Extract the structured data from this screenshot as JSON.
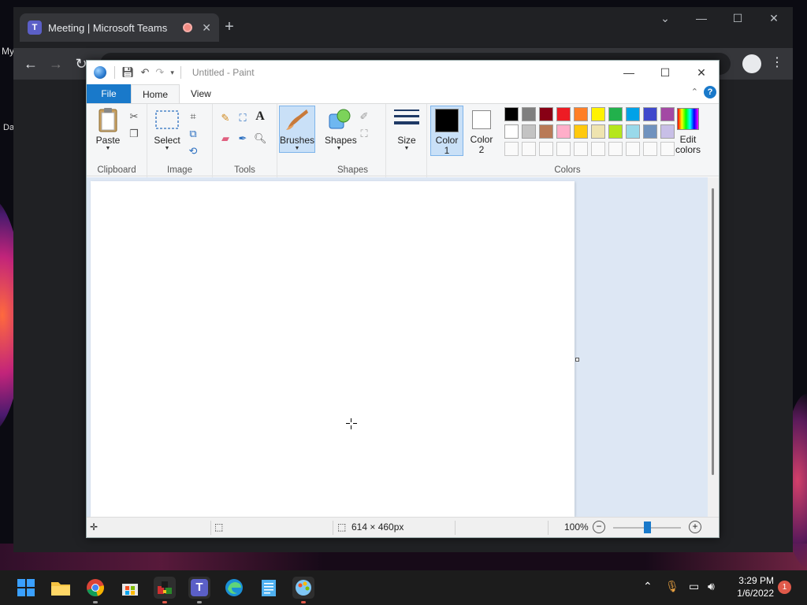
{
  "browser": {
    "tab_title": "Meeting | Microsoft Teams",
    "tab_icon": "T",
    "new_tab": "+",
    "desktop_partial_1": "My",
    "desktop_partial_2": "Da"
  },
  "paint": {
    "window_title": "Untitled - Paint",
    "tabs": {
      "file": "File",
      "home": "Home",
      "view": "View"
    },
    "help": "?",
    "clipboard": {
      "paste": "Paste",
      "group": "Clipboard"
    },
    "image": {
      "select": "Select",
      "group": "Image"
    },
    "tools": {
      "group": "Tools",
      "text_tool": "A"
    },
    "brushes": {
      "label": "Brushes"
    },
    "shapes": {
      "label": "Shapes",
      "group": "Shapes"
    },
    "size": {
      "label": "Size"
    },
    "colors": {
      "color1": "Color",
      "color1_num": "1",
      "color2": "Color",
      "color2_num": "2",
      "edit": "Edit",
      "edit2": "colors",
      "group": "Colors",
      "color1_value": "#000000",
      "color2_value": "#ffffff",
      "palette_row1": [
        "#000000",
        "#7f7f7f",
        "#880015",
        "#ed1c24",
        "#ff7f27",
        "#fff200",
        "#22b14c",
        "#00a2e8",
        "#3f48cc",
        "#a349a4"
      ],
      "palette_row2": [
        "#ffffff",
        "#c3c3c3",
        "#b97a57",
        "#ffaec9",
        "#ffc90e",
        "#efe4b0",
        "#b5e61d",
        "#99d9ea",
        "#7092be",
        "#c8bfe7"
      ]
    },
    "status": {
      "dimensions": "614 × 460px",
      "zoom": "100%",
      "zoom_level_fraction": 0.5
    }
  },
  "taskbar": {
    "time": "3:29 PM",
    "date": "1/6/2022",
    "notification_count": "1",
    "teams_label": "T"
  }
}
